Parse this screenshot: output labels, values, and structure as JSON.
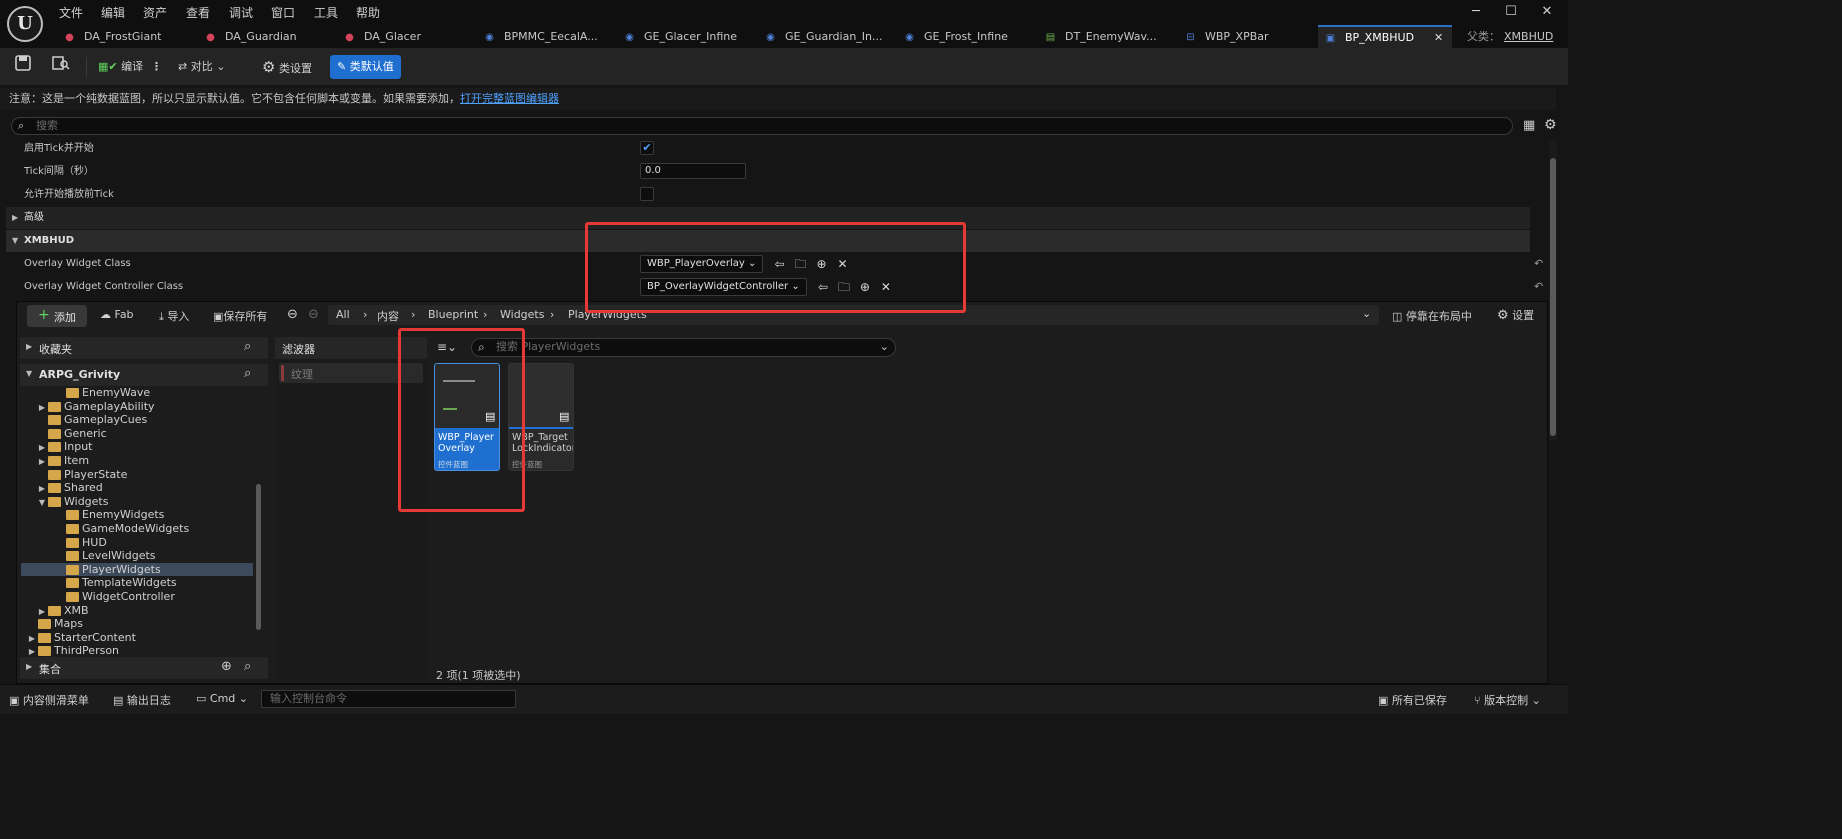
{
  "menu": [
    "文件",
    "编辑",
    "资产",
    "查看",
    "调试",
    "窗口",
    "工具",
    "帮助"
  ],
  "window_controls": {
    "minimize": "─",
    "maximize": "☐",
    "close": "✕"
  },
  "tabs": [
    {
      "label": "DA_FrostGiant",
      "icon": "data-asset-icon"
    },
    {
      "label": "DA_Guardian",
      "icon": "data-asset-icon"
    },
    {
      "label": "DA_Glacer",
      "icon": "data-asset-icon"
    },
    {
      "label": "BPMMC_EecalA...",
      "icon": "blueprint-icon"
    },
    {
      "label": "GE_Glacer_Infine",
      "icon": "blueprint-icon"
    },
    {
      "label": "GE_Guardian_In...",
      "icon": "blueprint-icon"
    },
    {
      "label": "GE_Frost_Infine",
      "icon": "blueprint-icon"
    },
    {
      "label": "DT_EnemyWav...",
      "icon": "data-table-icon"
    },
    {
      "label": "WBP_XPBar",
      "icon": "widget-blueprint-icon"
    },
    {
      "label": "BP_XMBHUD",
      "icon": "hud-blueprint-icon",
      "active": true
    }
  ],
  "parent_class": {
    "label": "父类：",
    "value": "XMBHUD"
  },
  "toolbar": {
    "compile": "编译",
    "diff": "对比",
    "class_settings": "类设置",
    "class_defaults": "类默认值"
  },
  "notice": {
    "text": "注意：这是一个纯数据蓝图，所以只显示默认值。它不包含任何脚本或变量。如果需要添加，",
    "link": "打开完整蓝图编辑器"
  },
  "details": {
    "search_placeholder": "搜索",
    "rows": [
      {
        "label": "启用Tick并开始",
        "checked": true
      },
      {
        "label": "Tick间隔（秒）",
        "value": "0.0"
      },
      {
        "label": "允许开始播放前Tick",
        "checked": false
      }
    ],
    "advanced": "高级",
    "category": "XMBHUD",
    "overlay_widget_class": {
      "label": "Overlay Widget Class",
      "value": "WBP_PlayerOverlay"
    },
    "overlay_controller_class": {
      "label": "Overlay Widget Controller Class",
      "value": "BP_OverlayWidgetController"
    }
  },
  "content_browser": {
    "add": "添加",
    "fab": "Fab",
    "import": "导入",
    "save_all": "保存所有",
    "breadcrumb": [
      "All",
      "内容",
      "Blueprint",
      "Widgets",
      "PlayerWidgets"
    ],
    "dock": "停靠在布局中",
    "settings": "设置",
    "favorites": "收藏夹",
    "project": "ARPG_Grivity",
    "filters": "滤波器",
    "filter_item": "纹理",
    "search_placeholder": "搜索 PlayerWidgets",
    "tree": [
      {
        "label": "EnemyWave",
        "indent": 3,
        "expand": ""
      },
      {
        "label": "GameplayAbility",
        "indent": 2,
        "expand": "▶"
      },
      {
        "label": "GameplayCues",
        "indent": 2,
        "expand": ""
      },
      {
        "label": "Generic",
        "indent": 2,
        "expand": ""
      },
      {
        "label": "Input",
        "indent": 2,
        "expand": "▶"
      },
      {
        "label": "Item",
        "indent": 2,
        "expand": "▶"
      },
      {
        "label": "PlayerState",
        "indent": 2,
        "expand": ""
      },
      {
        "label": "Shared",
        "indent": 2,
        "expand": "▶"
      },
      {
        "label": "Widgets",
        "indent": 2,
        "expand": "▼"
      },
      {
        "label": "EnemyWidgets",
        "indent": 3,
        "expand": ""
      },
      {
        "label": "GameModeWidgets",
        "indent": 3,
        "expand": ""
      },
      {
        "label": "HUD",
        "indent": 3,
        "expand": ""
      },
      {
        "label": "LevelWidgets",
        "indent": 3,
        "expand": ""
      },
      {
        "label": "PlayerWidgets",
        "indent": 3,
        "expand": "",
        "selected": true
      },
      {
        "label": "TemplateWidgets",
        "indent": 3,
        "expand": ""
      },
      {
        "label": "WidgetController",
        "indent": 3,
        "expand": ""
      },
      {
        "label": "XMB",
        "indent": 2,
        "expand": "▶"
      },
      {
        "label": "Maps",
        "indent": 1,
        "expand": ""
      },
      {
        "label": "StarterContent",
        "indent": 1,
        "expand": "▶"
      },
      {
        "label": "ThirdPerson",
        "indent": 1,
        "expand": "▶"
      }
    ],
    "collections": "集合",
    "assets": [
      {
        "name": "WBP_Player Overlay",
        "type": "控件蓝图",
        "selected": true
      },
      {
        "name": "WBP_Target LockIndicator",
        "type": "控件蓝图",
        "selected": false
      }
    ],
    "item_count": "2 项(1 项被选中)"
  },
  "statusbar": {
    "content_drawer": "内容侧滑菜单",
    "output_log": "输出日志",
    "cmd": "Cmd",
    "console_placeholder": "输入控制台命令",
    "all_saved": "所有已保存",
    "source_control": "版本控制"
  },
  "colors": {
    "accent": "#1e6fd0",
    "highlight_box": "#e53935",
    "folder": "#d6a64a",
    "link": "#4ea1ff"
  }
}
